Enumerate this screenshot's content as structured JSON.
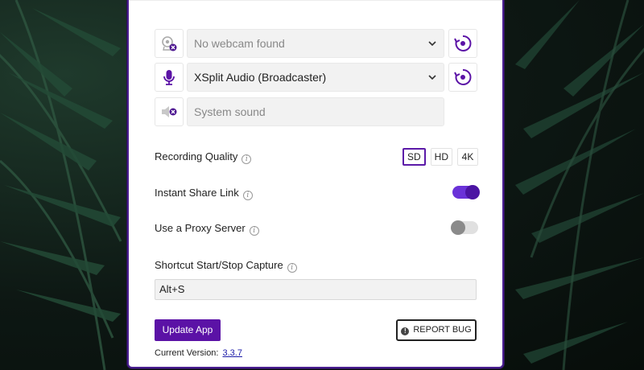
{
  "devices": {
    "webcam": {
      "icon": "webcam-off-icon",
      "value": "No webcam found",
      "action_icon": "refresh-icon"
    },
    "microphone": {
      "icon": "microphone-icon",
      "value": "XSplit Audio (Broadcaster)",
      "action_icon": "refresh-icon"
    },
    "system_sound": {
      "icon": "speaker-muted-icon",
      "value": "System sound"
    }
  },
  "settings": {
    "recording_quality": {
      "label": "Recording Quality",
      "options": [
        "SD",
        "HD",
        "4K"
      ],
      "selected": "SD"
    },
    "instant_share": {
      "label": "Instant Share Link",
      "enabled": true
    },
    "proxy": {
      "label": "Use a Proxy Server",
      "enabled": false
    },
    "shortcut": {
      "label": "Shortcut Start/Stop Capture",
      "value": "Alt+S"
    }
  },
  "footer": {
    "update_label": "Update App",
    "report_label": "REPORT BUG",
    "version_label": "Current Version:",
    "version_value": "3.3.7"
  },
  "colors": {
    "accent": "#5b12a6",
    "toggle_on": "#6a32d8",
    "border": "#4a1f91"
  }
}
